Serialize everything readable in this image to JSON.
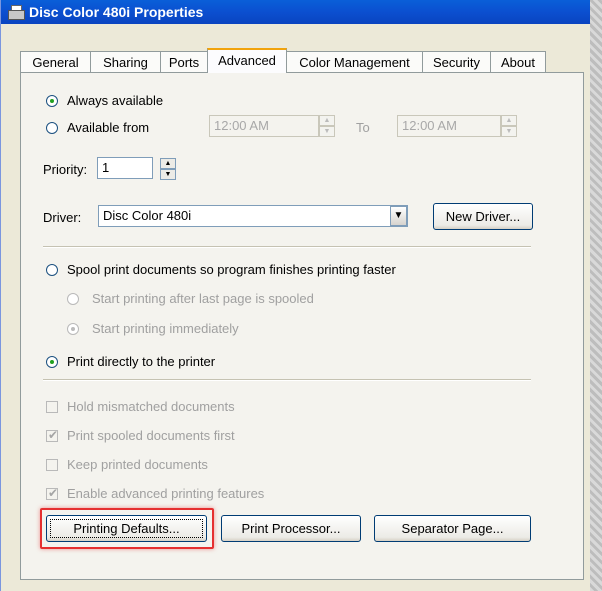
{
  "window": {
    "title": "Disc Color 480i Properties",
    "icon": "printer-icon"
  },
  "tabs": [
    {
      "label": "General"
    },
    {
      "label": "Sharing"
    },
    {
      "label": "Ports"
    },
    {
      "label": "Advanced"
    },
    {
      "label": "Color Management"
    },
    {
      "label": "Security"
    },
    {
      "label": "About"
    }
  ],
  "active_tab": "Advanced",
  "availability": {
    "always_label": "Always available",
    "from_label": "Available from",
    "from_time": "12:00 AM",
    "to_label": "To",
    "to_time": "12:00 AM",
    "selected": "always"
  },
  "priority": {
    "label": "Priority:",
    "value": "1"
  },
  "driver": {
    "label": "Driver:",
    "value": "Disc Color 480i",
    "new_button": "New Driver..."
  },
  "spool": {
    "spool_label": "Spool print documents so program finishes printing faster",
    "after_last_page_label": "Start printing after last page is spooled",
    "immediately_label": "Start printing immediately",
    "direct_label": "Print directly to the printer",
    "selected": "direct"
  },
  "options": [
    {
      "label": "Hold mismatched documents",
      "checked": false
    },
    {
      "label": "Print spooled documents first",
      "checked": true
    },
    {
      "label": "Keep printed documents",
      "checked": false
    },
    {
      "label": "Enable advanced printing features",
      "checked": true
    }
  ],
  "buttons": {
    "printing_defaults": "Printing Defaults...",
    "print_processor": "Print Processor...",
    "separator_page": "Separator Page..."
  },
  "colors": {
    "title_bar": "#0a5fd8",
    "highlight": "#e53030",
    "radio_dot": "#21a121"
  }
}
